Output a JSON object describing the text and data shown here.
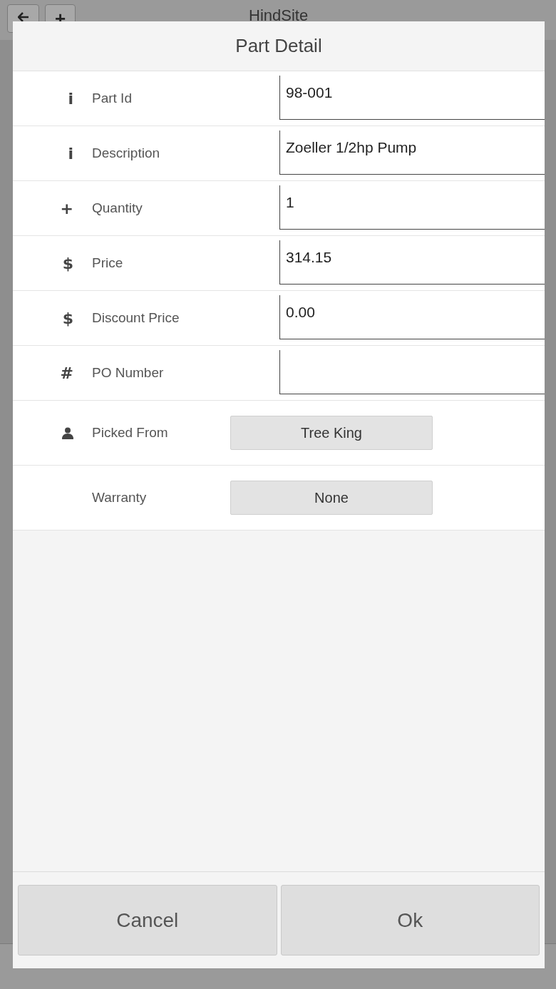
{
  "app_bar": {
    "title": "HindSite",
    "add_button": "+"
  },
  "dialog": {
    "title": "Part Detail",
    "fields": [
      {
        "kind": "input",
        "icon": "i",
        "label": "Part Id",
        "value": "98-001"
      },
      {
        "kind": "input",
        "icon": "i",
        "label": "Description",
        "value": "Zoeller 1/2hp Pump"
      },
      {
        "kind": "input",
        "icon": "+",
        "label": "Quantity",
        "value": "1"
      },
      {
        "kind": "input",
        "icon": "$",
        "label": "Price",
        "value": "314.15"
      },
      {
        "kind": "input",
        "icon": "$",
        "label": "Discount Price",
        "value": "0.00"
      },
      {
        "kind": "input",
        "icon": "#",
        "label": "PO Number"
      },
      {
        "kind": "person_picker",
        "label": "Picked From",
        "value": "Tree King"
      },
      {
        "kind": "picker",
        "label": "Warranty",
        "value": "None"
      }
    ],
    "buttons": [
      "Cancel",
      "Ok"
    ]
  }
}
